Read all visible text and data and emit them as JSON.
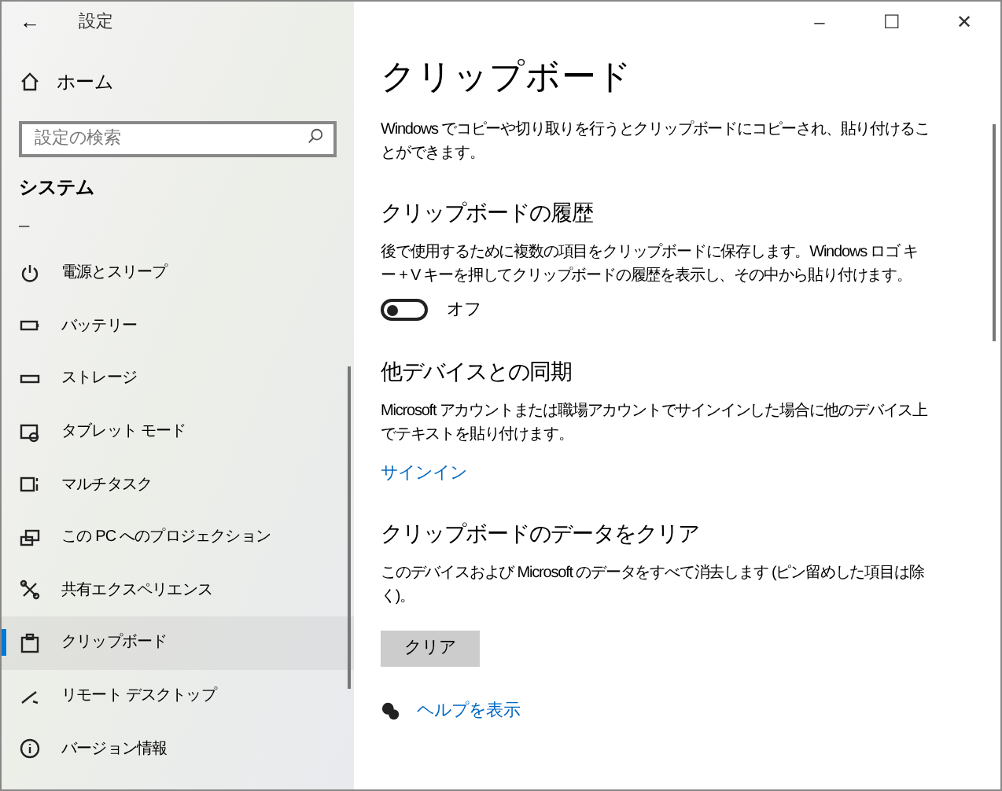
{
  "window": {
    "title": "設定",
    "back": "←",
    "controls": [
      "–",
      "☐",
      "✕"
    ]
  },
  "sidebar": {
    "home": "ホーム",
    "search": {
      "placeholder": "設定の検索"
    },
    "section": "システム",
    "dash": "–",
    "items": [
      {
        "label": "電源とスリープ",
        "kind": "power",
        "selected": false
      },
      {
        "label": "バッテリー",
        "kind": "battery",
        "selected": false
      },
      {
        "label": "ストレージ",
        "kind": "storage",
        "selected": false
      },
      {
        "label": "タブレット モード",
        "kind": "tablet",
        "selected": false
      },
      {
        "label": "マルチタスク",
        "kind": "multitask",
        "selected": false
      },
      {
        "label": "この PC へのプロジェクション",
        "kind": "projection",
        "selected": false
      },
      {
        "label": "共有エクスペリエンス",
        "kind": "share",
        "selected": false
      },
      {
        "label": "クリップボード",
        "kind": "clipboard",
        "selected": true
      },
      {
        "label": "リモート デスクトップ",
        "kind": "remote",
        "selected": false
      },
      {
        "label": "バージョン情報",
        "kind": "info",
        "selected": false
      }
    ]
  },
  "content": {
    "title": "クリップボード",
    "intro": "Windows でコピーや切り取りを行うとクリップボードにコピーされ、貼り付けることができます。",
    "sections": [
      {
        "heading": "クリップボードの履歴",
        "text": "後で使用するために複数の項目をクリップボードに保存します。Windows ロゴ キー + V キーを押してクリップボードの履歴を表示し、その中から貼り付けます。",
        "kind": "toggle",
        "on": false,
        "state_label": "オフ"
      },
      {
        "heading": "他デバイスとの同期",
        "text": "Microsoft アカウントまたは職場アカウントでサインインした場合に他のデバイス上でテキストを貼り付けます。",
        "kind": "link",
        "link": "サインイン"
      },
      {
        "heading": "クリップボードのデータをクリア",
        "text": "このデバイスおよび Microsoft のデータをすべて消去します (ピン留めした項目は除く)。",
        "kind": "button",
        "button": "クリア"
      }
    ],
    "help_link": "ヘルプを表示"
  }
}
